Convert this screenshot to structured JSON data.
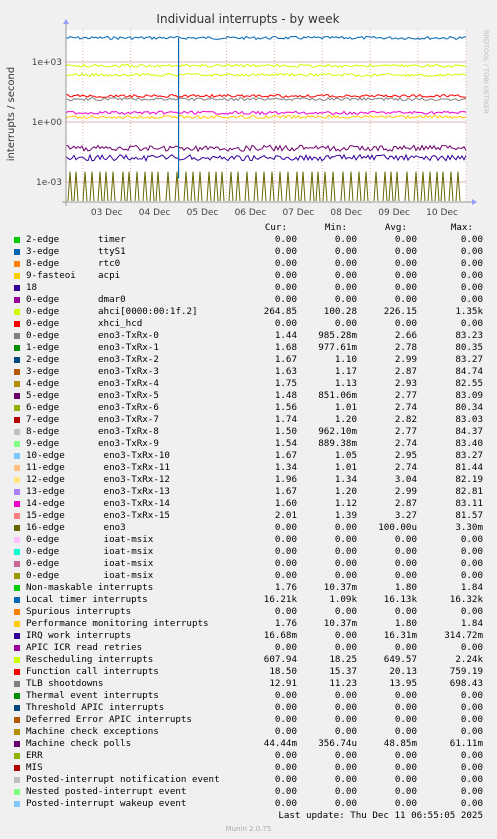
{
  "chart_data": {
    "type": "line",
    "title": "Individual interrupts - by week",
    "ylabel": "interrupts / second",
    "xlabel": "",
    "scale": "log",
    "ylim": [
      0.0001,
      40000
    ],
    "x_ticks": [
      "03 Dec",
      "04 Dec",
      "05 Dec",
      "06 Dec",
      "07 Dec",
      "08 Dec",
      "09 Dec",
      "10 Dec"
    ],
    "y_ticks": [
      "1e+03",
      "1e+00",
      "1e-03"
    ],
    "grid": true,
    "watermark": "RRDTOOL / TOBI OETIKER",
    "columns": [
      "Cur:",
      "Min:",
      "Avg:",
      "Max:"
    ],
    "series": [
      {
        "name": "2-edge",
        "sub": "timer",
        "color": "#00cc00",
        "cur": "0.00",
        "min": "0.00",
        "avg": "0.00",
        "max": "0.00"
      },
      {
        "name": "3-edge",
        "sub": "ttyS1",
        "color": "#0066b3",
        "cur": "0.00",
        "min": "0.00",
        "avg": "0.00",
        "max": "0.00"
      },
      {
        "name": "8-edge",
        "sub": "rtc0",
        "color": "#ff8000",
        "cur": "0.00",
        "min": "0.00",
        "avg": "0.00",
        "max": "0.00"
      },
      {
        "name": "9-fasteoi",
        "sub": "acpi",
        "color": "#ffcc00",
        "cur": "0.00",
        "min": "0.00",
        "avg": "0.00",
        "max": "0.00"
      },
      {
        "name": "18",
        "sub": "",
        "color": "#330099",
        "cur": "0.00",
        "min": "0.00",
        "avg": "0.00",
        "max": "0.00"
      },
      {
        "name": "0-edge",
        "sub": "dmar0",
        "color": "#990099",
        "cur": "0.00",
        "min": "0.00",
        "avg": "0.00",
        "max": "0.00"
      },
      {
        "name": "0-edge",
        "sub": "ahci[0000:00:1f.2]",
        "color": "#ccff00",
        "cur": "264.85",
        "min": "100.28",
        "avg": "226.15",
        "max": "1.35k"
      },
      {
        "name": "0-edge",
        "sub": "xhci_hcd",
        "color": "#ff0000",
        "cur": "0.00",
        "min": "0.00",
        "avg": "0.00",
        "max": "0.00"
      },
      {
        "name": "0-edge",
        "sub": "eno3-TxRx-0",
        "color": "#808080",
        "cur": "1.44",
        "min": "985.28m",
        "avg": "2.66",
        "max": "83.23"
      },
      {
        "name": "1-edge",
        "sub": "eno3-TxRx-1",
        "color": "#008f00",
        "cur": "1.68",
        "min": "977.61m",
        "avg": "2.78",
        "max": "80.35"
      },
      {
        "name": "2-edge",
        "sub": "eno3-TxRx-2",
        "color": "#00487d",
        "cur": "1.67",
        "min": "1.10",
        "avg": "2.99",
        "max": "83.27"
      },
      {
        "name": "3-edge",
        "sub": "eno3-TxRx-3",
        "color": "#b35a00",
        "cur": "1.63",
        "min": "1.17",
        "avg": "2.87",
        "max": "84.74"
      },
      {
        "name": "4-edge",
        "sub": "eno3-TxRx-4",
        "color": "#b38f00",
        "cur": "1.75",
        "min": "1.13",
        "avg": "2.93",
        "max": "82.55"
      },
      {
        "name": "5-edge",
        "sub": "eno3-TxRx-5",
        "color": "#6b006b",
        "cur": "1.48",
        "min": "851.06m",
        "avg": "2.77",
        "max": "83.09"
      },
      {
        "name": "6-edge",
        "sub": "eno3-TxRx-6",
        "color": "#8fb300",
        "cur": "1.56",
        "min": "1.01",
        "avg": "2.74",
        "max": "80.34"
      },
      {
        "name": "7-edge",
        "sub": "eno3-TxRx-7",
        "color": "#b30000",
        "cur": "1.74",
        "min": "1.20",
        "avg": "2.82",
        "max": "83.03"
      },
      {
        "name": "8-edge",
        "sub": "eno3-TxRx-8",
        "color": "#bebebe",
        "cur": "1.50",
        "min": "962.10m",
        "avg": "2.77",
        "max": "84.37"
      },
      {
        "name": "9-edge",
        "sub": "eno3-TxRx-9",
        "color": "#80ff80",
        "cur": "1.54",
        "min": "889.38m",
        "avg": "2.74",
        "max": "83.40"
      },
      {
        "name": "10-edge",
        "sub": " eno3-TxRx-10",
        "color": "#80c9ff",
        "cur": "1.67",
        "min": "1.05",
        "avg": "2.95",
        "max": "83.27"
      },
      {
        "name": "11-edge",
        "sub": " eno3-TxRx-11",
        "color": "#ffc080",
        "cur": "1.34",
        "min": "1.01",
        "avg": "2.74",
        "max": "81.44"
      },
      {
        "name": "12-edge",
        "sub": " eno3-TxRx-12",
        "color": "#ffe680",
        "cur": "1.96",
        "min": "1.34",
        "avg": "3.04",
        "max": "82.19"
      },
      {
        "name": "13-edge",
        "sub": " eno3-TxRx-13",
        "color": "#aa80ff",
        "cur": "1.67",
        "min": "1.20",
        "avg": "2.99",
        "max": "82.81"
      },
      {
        "name": "14-edge",
        "sub": " eno3-TxRx-14",
        "color": "#ee00cc",
        "cur": "1.60",
        "min": "1.12",
        "avg": "2.87",
        "max": "83.11"
      },
      {
        "name": "15-edge",
        "sub": " eno3-TxRx-15",
        "color": "#ff8080",
        "cur": "2.01",
        "min": "1.39",
        "avg": "3.27",
        "max": "81.57"
      },
      {
        "name": "16-edge",
        "sub": " eno3",
        "color": "#666600",
        "cur": "0.00",
        "min": "0.00",
        "avg": "100.00u",
        "max": "3.30m"
      },
      {
        "name": "0-edge",
        "sub": " ioat-msix",
        "color": "#ffbfff",
        "cur": "0.00",
        "min": "0.00",
        "avg": "0.00",
        "max": "0.00"
      },
      {
        "name": "0-edge",
        "sub": " ioat-msix",
        "color": "#00ffcc",
        "cur": "0.00",
        "min": "0.00",
        "avg": "0.00",
        "max": "0.00"
      },
      {
        "name": "0-edge",
        "sub": " ioat-msix",
        "color": "#cc6699",
        "cur": "0.00",
        "min": "0.00",
        "avg": "0.00",
        "max": "0.00"
      },
      {
        "name": "0-edge",
        "sub": " ioat-msix",
        "color": "#999900",
        "cur": "0.00",
        "min": "0.00",
        "avg": "0.00",
        "max": "0.00"
      },
      {
        "name": "Non-maskable interrupts",
        "sub": "",
        "color": "#00cc00",
        "cur": "1.76",
        "min": "10.37m",
        "avg": "1.80",
        "max": "1.84"
      },
      {
        "name": "Local timer interrupts",
        "sub": "",
        "color": "#0066b3",
        "cur": "16.21k",
        "min": "1.09k",
        "avg": "16.13k",
        "max": "16.32k"
      },
      {
        "name": "Spurious interrupts",
        "sub": "",
        "color": "#ff8000",
        "cur": "0.00",
        "min": "0.00",
        "avg": "0.00",
        "max": "0.00"
      },
      {
        "name": "Performance monitoring interrupts",
        "sub": "",
        "color": "#ffcc00",
        "cur": "1.76",
        "min": "10.37m",
        "avg": "1.80",
        "max": "1.84"
      },
      {
        "name": "IRQ work interrupts",
        "sub": "",
        "color": "#330099",
        "cur": "16.68m",
        "min": "0.00",
        "avg": "16.31m",
        "max": "314.72m"
      },
      {
        "name": "APIC ICR read retries",
        "sub": "",
        "color": "#990099",
        "cur": "0.00",
        "min": "0.00",
        "avg": "0.00",
        "max": "0.00"
      },
      {
        "name": "Rescheduling interrupts",
        "sub": "",
        "color": "#ccff00",
        "cur": "607.94",
        "min": "18.25",
        "avg": "649.57",
        "max": "2.24k"
      },
      {
        "name": "Function call interrupts",
        "sub": "",
        "color": "#ff0000",
        "cur": "18.50",
        "min": "15.37",
        "avg": "20.13",
        "max": "759.19"
      },
      {
        "name": "TLB shootdowns",
        "sub": "",
        "color": "#808080",
        "cur": "12.91",
        "min": "11.23",
        "avg": "13.95",
        "max": "698.43"
      },
      {
        "name": "Thermal event interrupts",
        "sub": "",
        "color": "#008f00",
        "cur": "0.00",
        "min": "0.00",
        "avg": "0.00",
        "max": "0.00"
      },
      {
        "name": "Threshold APIC interrupts",
        "sub": "",
        "color": "#00487d",
        "cur": "0.00",
        "min": "0.00",
        "avg": "0.00",
        "max": "0.00"
      },
      {
        "name": "Deferred Error APIC interrupts",
        "sub": "",
        "color": "#b35a00",
        "cur": "0.00",
        "min": "0.00",
        "avg": "0.00",
        "max": "0.00"
      },
      {
        "name": "Machine check exceptions",
        "sub": "",
        "color": "#b38f00",
        "cur": "0.00",
        "min": "0.00",
        "avg": "0.00",
        "max": "0.00"
      },
      {
        "name": "Machine check polls",
        "sub": "",
        "color": "#6b006b",
        "cur": "44.44m",
        "min": "356.74u",
        "avg": "48.85m",
        "max": "61.11m"
      },
      {
        "name": "ERR",
        "sub": "",
        "color": "#8fb300",
        "cur": "0.00",
        "min": "0.00",
        "avg": "0.00",
        "max": "0.00"
      },
      {
        "name": "MIS",
        "sub": "",
        "color": "#b30000",
        "cur": "0.00",
        "min": "0.00",
        "avg": "0.00",
        "max": "0.00"
      },
      {
        "name": "Posted-interrupt notification event",
        "sub": "",
        "color": "#bebebe",
        "cur": "0.00",
        "min": "0.00",
        "avg": "0.00",
        "max": "0.00"
      },
      {
        "name": "Nested posted-interrupt event",
        "sub": "",
        "color": "#80ff80",
        "cur": "0.00",
        "min": "0.00",
        "avg": "0.00",
        "max": "0.00"
      },
      {
        "name": "Posted-interrupt wakeup event",
        "sub": "",
        "color": "#80c9ff",
        "cur": "0.00",
        "min": "0.00",
        "avg": "0.00",
        "max": "0.00"
      }
    ],
    "plotted_levels": [
      {
        "label": "Local timer interrupts",
        "value": 16130,
        "color": "#0066b3"
      },
      {
        "label": "Rescheduling interrupts",
        "value": 649.57,
        "color": "#ccff00"
      },
      {
        "label": "ahci[0000:00:1f.2]",
        "value": 226.15,
        "color": "#ccff00"
      },
      {
        "label": "Function call interrupts",
        "value": 20.13,
        "color": "#ff0000"
      },
      {
        "label": "TLB shootdowns",
        "value": 13.95,
        "color": "#808080"
      },
      {
        "label": "eno3-TxRx",
        "value": 2.9,
        "color": "#ee00cc"
      },
      {
        "label": "Non-maskable interrupts",
        "value": 1.8,
        "color": "#ffcc00"
      },
      {
        "label": "Machine check polls",
        "value": 0.04885,
        "color": "#6b006b"
      },
      {
        "label": "IRQ work interrupts",
        "value": 0.01631,
        "color": "#330099"
      }
    ]
  },
  "footer": {
    "last_update": "Last update: Thu Dec 11 06:55:05 2025",
    "munin_version": "Munin 2.0.75"
  }
}
